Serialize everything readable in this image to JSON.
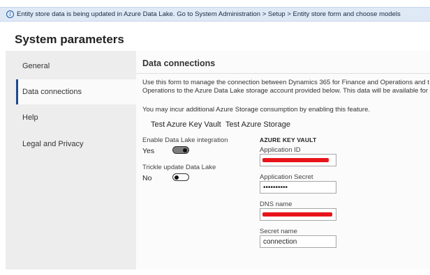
{
  "banner": {
    "icon": "info-icon",
    "message": "Entity store data is being updated in Azure Data Lake. Go to System Administration > Setup > Entity store form and choose models"
  },
  "page": {
    "title": "System parameters"
  },
  "nav": {
    "items": [
      {
        "label": "General",
        "active": false
      },
      {
        "label": "Data connections",
        "active": true
      },
      {
        "label": "Help",
        "active": false
      },
      {
        "label": "Legal and Privacy",
        "active": false
      }
    ]
  },
  "section": {
    "title": "Data connections",
    "desc_line1": "Use this form to manage the connection between Dynamics 365 for Finance and Operations and t",
    "desc_line2": "Operations to the Azure Data Lake storage account provided below. This data will be available for",
    "note": "You may incur additional Azure Storage consumption by enabling this feature."
  },
  "actions": {
    "test_key_vault": "Test Azure Key Vault",
    "test_storage": "Test Azure Storage"
  },
  "toggles": {
    "data_lake": {
      "label": "Enable Data Lake integration",
      "value": "Yes",
      "on": true
    },
    "trickle": {
      "label": "Trickle update Data Lake",
      "value": "No",
      "on": false
    }
  },
  "key_vault": {
    "heading": "AZURE KEY VAULT",
    "app_id_label": "Application ID",
    "app_secret_label": "Application Secret",
    "app_secret_value": "••••••••••",
    "dns_label": "DNS name",
    "secret_name_label": "Secret name",
    "secret_name_value": "connection"
  },
  "colors": {
    "banner_bg": "#dfe9f6",
    "active_accent": "#1e4b8f",
    "redaction": "#e8141b"
  }
}
